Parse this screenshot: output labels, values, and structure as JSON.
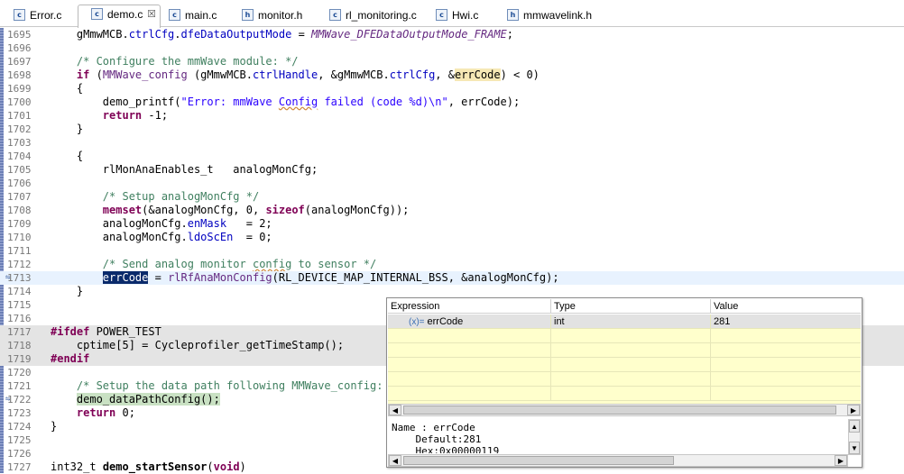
{
  "tabs": [
    {
      "label": "Error.c",
      "icon": "c-file-icon",
      "active": false
    },
    {
      "label": "demo.c",
      "icon": "c-file-icon",
      "active": true
    },
    {
      "label": "main.c",
      "icon": "c-file-icon",
      "active": false
    },
    {
      "label": "monitor.h",
      "icon": "h-file-icon",
      "active": false
    },
    {
      "label": "rl_monitoring.c",
      "icon": "c-file-icon",
      "active": false
    },
    {
      "label": "Hwi.c",
      "icon": "c-file-icon",
      "active": false
    },
    {
      "label": "mmwavelink.h",
      "icon": "h-file-icon",
      "active": false
    }
  ],
  "close_glyph": "☒",
  "code": {
    "line_numbers": [
      "1695",
      "1696",
      "1697",
      "1698",
      "1699",
      "1700",
      "1701",
      "1702",
      "1703",
      "1704",
      "1705",
      "1706",
      "1707",
      "1708",
      "1709",
      "1710",
      "1711",
      "1712",
      "1713",
      "1714",
      "1715",
      "1716",
      "1717",
      "1718",
      "1719",
      "1720",
      "1721",
      "1722",
      "1723",
      "1724",
      "1725",
      "1726",
      "1727"
    ],
    "l1695": [
      "    gMmwMCB.",
      "ctrlCfg",
      ".",
      "dfeDataOutputMode",
      " = ",
      "MMWave_DFEDataOutputMode_FRAME",
      ";"
    ],
    "l1697": "    /* Configure the mmWave module: */",
    "l1698": [
      "    ",
      "if",
      " (",
      "MMWave_config",
      " (gMmwMCB.",
      "ctrlHandle",
      ", &gMmwMCB.",
      "ctrlCfg",
      ", &",
      "errCode",
      ") < 0)"
    ],
    "l1699": "    {",
    "l1700": [
      "        demo_printf(",
      "\"Error: mmWave ",
      "Config",
      " failed (code %d)\\n\"",
      ", errCode);"
    ],
    "l1701": [
      "        ",
      "return",
      " -1;"
    ],
    "l1702": "    }",
    "l1704": "    {",
    "l1705": "        rlMonAnaEnables_t   analogMonCfg;",
    "l1707": "        /* Setup analogMonCfg */",
    "l1708": [
      "        ",
      "memset",
      "(&analogMonCfg, 0, ",
      "sizeof",
      "(analogMonCfg));"
    ],
    "l1709": [
      "        analogMonCfg.",
      "enMask",
      "   = 2;"
    ],
    "l1710": [
      "        analogMonCfg.",
      "ldoScEn",
      "  = 0;"
    ],
    "l1712": [
      "        /* Send analog monitor ",
      "config",
      " to sensor */"
    ],
    "l1713": [
      "        ",
      "errCode",
      " = ",
      "rlRfAnaMonConfig",
      "(RL_DEVICE_MAP_INTERNAL_BSS, &analogMonCfg);"
    ],
    "l1714": "    }",
    "l1717": [
      "#ifdef",
      " POWER_TEST"
    ],
    "l1718": "    cptime[5] = Cycleprofiler_getTimeStamp();",
    "l1719": "#endif",
    "l1721": "    /* Setup the data path following MMWave_config: */",
    "l1722": [
      "    ",
      "demo_dataPathConfig();"
    ],
    "l1723": [
      "    ",
      "return",
      " 0;"
    ],
    "l1724": "}",
    "l1727": [
      "int32_t",
      " ",
      "demo_startSensor",
      "(",
      "void",
      ")"
    ]
  },
  "expressions": {
    "headers": [
      "Expression",
      "Type",
      "Value"
    ],
    "row": {
      "icon": "variable-icon",
      "icon_glyph": "(x)=",
      "name": "errCode",
      "type": "int",
      "value": "281"
    },
    "detail_line1": "Name : errCode",
    "detail_line2": "    Default:281",
    "detail_line3": "    Hex:0x00000119"
  }
}
